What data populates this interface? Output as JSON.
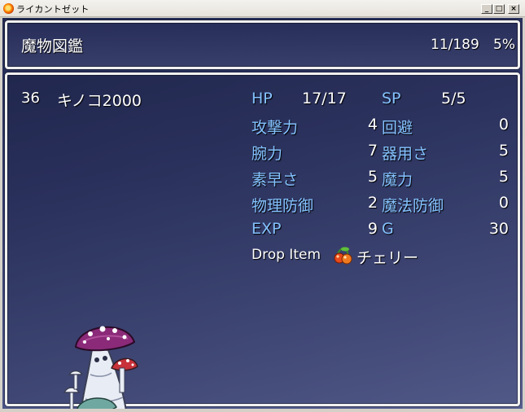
{
  "window": {
    "title": "ライカントゼット",
    "buttons": {
      "minimize": "_",
      "maximize": "□",
      "close": "×"
    }
  },
  "header": {
    "title": "魔物図鑑",
    "progress": "11/189",
    "percent": "5%"
  },
  "monster": {
    "number": "36",
    "name": "キノコ2000",
    "hp_label": "HP",
    "hp_value": "17/17",
    "sp_label": "SP",
    "sp_value": "5/5",
    "stats_left": [
      {
        "label": "攻撃力",
        "value": "4"
      },
      {
        "label": "腕力",
        "value": "7"
      },
      {
        "label": "素早さ",
        "value": "5"
      },
      {
        "label": "物理防御",
        "value": "2"
      },
      {
        "label": "EXP",
        "value": "9"
      }
    ],
    "stats_right": [
      {
        "label": "回避",
        "value": "0"
      },
      {
        "label": "器用さ",
        "value": "5"
      },
      {
        "label": "魔力",
        "value": "5"
      },
      {
        "label": "魔法防御",
        "value": "0"
      },
      {
        "label": "G",
        "value": "30"
      }
    ],
    "drop_label": "Drop Item",
    "drop_item": "チェリー",
    "drop_icon": "cherry-icon"
  },
  "colors": {
    "system_text": "#84c2ff",
    "normal_text": "#ffffff",
    "window_border": "#f0f0f0"
  }
}
